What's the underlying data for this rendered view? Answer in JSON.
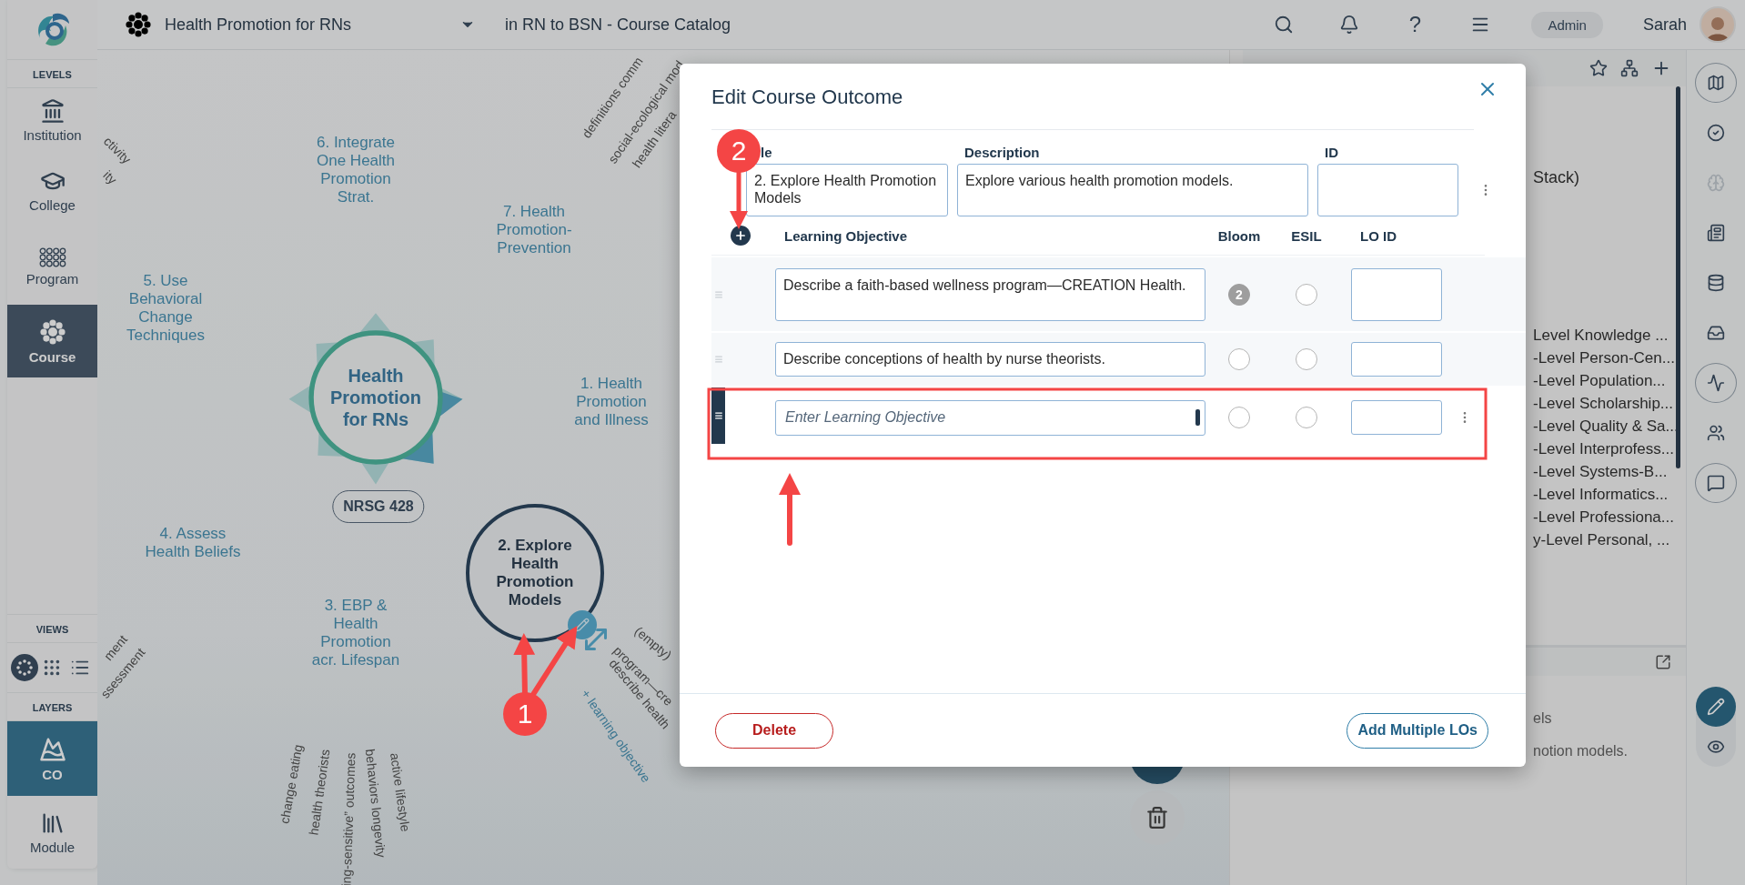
{
  "top_bar": {
    "course_title": "Health Promotion for RNs",
    "context": "in RN to BSN - Course Catalog",
    "help": "?",
    "role": "Admin",
    "user": "Sarah"
  },
  "sidebar": {
    "levels_label": "LEVELS",
    "levels": [
      {
        "label": "Institution",
        "kind": "institution",
        "selected": false
      },
      {
        "label": "College",
        "kind": "college",
        "selected": false
      },
      {
        "label": "Program",
        "kind": "program",
        "selected": false
      },
      {
        "label": "Course",
        "kind": "course",
        "selected": true
      }
    ],
    "views_label": "VIEWS",
    "views": [
      {
        "kind": "radial",
        "selected": true
      },
      {
        "kind": "grid",
        "selected": false
      },
      {
        "kind": "list",
        "selected": false
      }
    ],
    "layers_label": "LAYERS",
    "layers": [
      {
        "label": "CO",
        "kind": "co",
        "selected": true
      },
      {
        "label": "Module",
        "kind": "module",
        "selected": false
      }
    ]
  },
  "canvas": {
    "course": {
      "title": "Health Promotion for RNs",
      "code": "NRSG 428"
    },
    "outcomes": [
      {
        "label": "6. Integrate One Health Promotion Strat.",
        "selected": false
      },
      {
        "label": "7. Health Promotion-Prevention",
        "selected": false
      },
      {
        "label": "5. Use Behavioral Change Techniques",
        "selected": false
      },
      {
        "label": "1. Health Promotion and Illness",
        "selected": false
      },
      {
        "label": "4. Assess Health Beliefs",
        "selected": false
      },
      {
        "label": "2. Explore Health Promotion Models",
        "selected": true
      },
      {
        "label": "3. EBP & Health Promotion acr. Lifespan",
        "selected": false
      }
    ],
    "terms": [
      {
        "text": "definitions comm",
        "kind": "term"
      },
      {
        "text": "social-ecological mod",
        "kind": "term"
      },
      {
        "text": "health litera",
        "kind": "term"
      },
      {
        "text": "ctivity",
        "kind": "term"
      },
      {
        "text": "ity",
        "kind": "term"
      },
      {
        "text": "ment",
        "kind": "term"
      },
      {
        "text": "ssessment",
        "kind": "term"
      },
      {
        "text": "(empty)",
        "kind": "term"
      },
      {
        "text": "program—cre",
        "kind": "term"
      },
      {
        "text": "describe health",
        "kind": "term"
      },
      {
        "text": "learning objective",
        "kind": "add",
        "icon": "+"
      },
      {
        "text": "change eating",
        "kind": "term"
      },
      {
        "text": "health theorists",
        "kind": "term"
      },
      {
        "text": "ing-sensitive” outcomes",
        "kind": "term"
      },
      {
        "text": "behaviors longevity",
        "kind": "term"
      },
      {
        "text": "active lifestyle",
        "kind": "term"
      }
    ]
  },
  "right_panel": {
    "heading_fragment": "Stack)",
    "items": [
      "Level Knowledge ...",
      "-Level Person-Cen...",
      "-Level Population...",
      "-Level Scholarship...",
      "-Level Quality & Sa...",
      "-Level Interprofess...",
      "-Level Systems-B...",
      "-Level Informatics...",
      "-Level Professiona...",
      "y-Level Personal, ..."
    ],
    "footer_lines": [
      "els",
      "notion models."
    ]
  },
  "right_rail": [
    {
      "kind": "map",
      "disabled": false
    },
    {
      "kind": "check",
      "disabled": false
    },
    {
      "kind": "brain",
      "disabled": true
    },
    {
      "kind": "document",
      "disabled": false
    },
    {
      "kind": "stack",
      "disabled": false
    },
    {
      "kind": "tray",
      "disabled": false
    },
    {
      "kind": "pulse",
      "disabled": false
    },
    {
      "kind": "users",
      "disabled": false
    },
    {
      "kind": "chat",
      "disabled": false
    }
  ],
  "modal": {
    "title": "Edit Course Outcome",
    "columns": {
      "title": "le",
      "description": "Description",
      "id": "ID"
    },
    "outcome": {
      "title": "2. Explore Health Promotion Models",
      "description": "Explore various health promotion models."
    },
    "lo_columns": {
      "objective": "Learning Objective",
      "bloom": "Bloom",
      "esil": "ESIL",
      "lo_id": "LO ID"
    },
    "objectives": [
      {
        "text": "Describe a faith-based wellness program—CREATION Health.",
        "bloom": "2",
        "bloom_checked": true,
        "esil": false,
        "selected": false
      },
      {
        "text": "Describe conceptions of health by nurse theorists.",
        "bloom_checked": false,
        "esil": false,
        "selected": false
      },
      {
        "placeholder": "Enter Learning Objective",
        "bloom_checked": false,
        "esil": false,
        "selected": true
      }
    ],
    "buttons": {
      "delete": "Delete",
      "add_multiple": "Add Multiple LOs"
    }
  },
  "annotations": [
    {
      "label": "1"
    },
    {
      "label": "2"
    }
  ]
}
